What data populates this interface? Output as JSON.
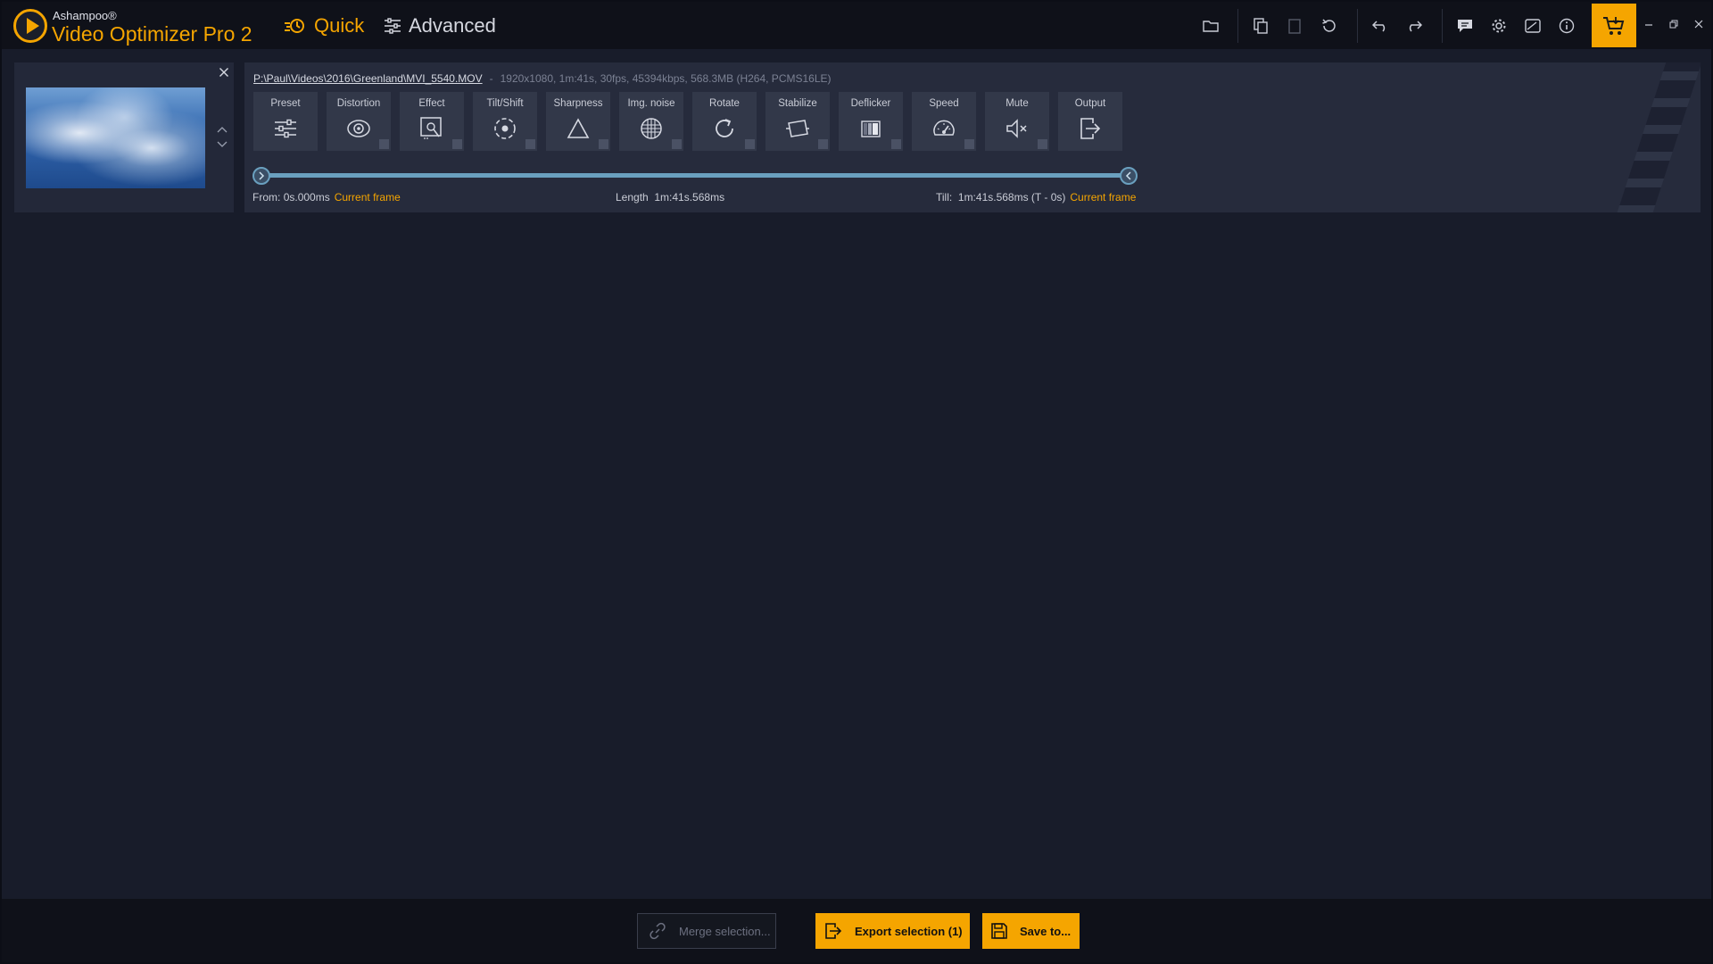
{
  "app": {
    "vendor": "Ashampoo®",
    "product": "Video Optimizer Pro 2"
  },
  "modes": {
    "quick": "Quick",
    "advanced": "Advanced"
  },
  "toolbar_icons": [
    "folder-icon",
    "copy-icon",
    "paste-icon",
    "reset-icon",
    "undo-icon",
    "redo-icon",
    "feedback-icon",
    "settings-icon",
    "picture-icon",
    "info-icon",
    "cart-icon"
  ],
  "clip": {
    "path": "P:\\Paul\\Videos\\2016\\Greenland\\MVI_5540.MOV",
    "separator": "-",
    "info": "1920x1080, 1m:41s, 30fps, 45394kbps, 568.3MB (H264, PCMS16LE)"
  },
  "tools": [
    {
      "label": "Preset",
      "icon": "sliders-icon"
    },
    {
      "label": "Distortion",
      "icon": "eye-icon"
    },
    {
      "label": "Effect",
      "icon": "magic-effect-icon"
    },
    {
      "label": "Tilt/Shift",
      "icon": "tilt-shift-icon"
    },
    {
      "label": "Sharpness",
      "icon": "triangle-icon"
    },
    {
      "label": "Img. noise",
      "icon": "noise-grid-icon"
    },
    {
      "label": "Rotate",
      "icon": "rotate-icon"
    },
    {
      "label": "Stabilize",
      "icon": "stabilize-icon"
    },
    {
      "label": "Deflicker",
      "icon": "deflicker-icon"
    },
    {
      "label": "Speed",
      "icon": "speedometer-icon"
    },
    {
      "label": "Mute",
      "icon": "mute-icon"
    },
    {
      "label": "Output",
      "icon": "output-icon"
    }
  ],
  "range": {
    "from_label": "From:",
    "from_value": "0s.000ms",
    "current_frame": "Current frame",
    "length_label": "Length",
    "length_value": "1m:41s.568ms",
    "till_label": "Till:",
    "till_value": "1m:41s.568ms (T - 0s)",
    "start_fraction": 0.0,
    "end_fraction": 1.0
  },
  "bottom": {
    "merge": "Merge selection...",
    "export": "Export selection (1)",
    "save": "Save to..."
  },
  "colors": {
    "accent": "#f5a500",
    "background": "#181c2a",
    "panel": "#262b3c",
    "slider": "#6aa0bf"
  }
}
